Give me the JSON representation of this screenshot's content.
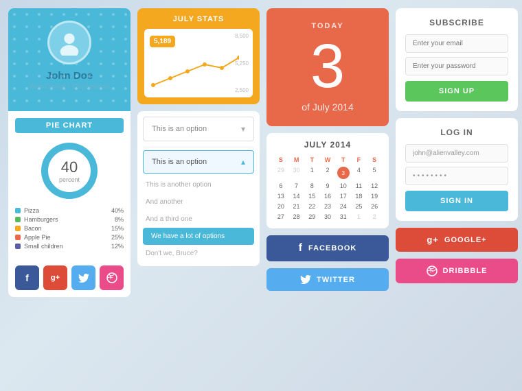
{
  "profile": {
    "name": "John Doe",
    "subtitle": "Web Design | Cluj Napoca",
    "pie_chart_label": "PIE CHART",
    "donut_value": "40",
    "donut_label": "percent",
    "legend": [
      {
        "label": "Pizza",
        "pct": "40%",
        "color": "#4ab8d8"
      },
      {
        "label": "Hamburgers",
        "pct": "8%",
        "color": "#5cb85c"
      },
      {
        "label": "Bacon",
        "pct": "15%",
        "color": "#f4a820"
      },
      {
        "label": "Apple Pie",
        "pct": "25%",
        "color": "#e8684a"
      },
      {
        "label": "Small children",
        "pct": "12%",
        "color": "#5b5ea6"
      }
    ]
  },
  "social_small": {
    "buttons": [
      "f",
      "g+",
      "t",
      "d"
    ]
  },
  "stats": {
    "title": "JULY STATS",
    "badge": "5,189",
    "y_labels": [
      "8,500",
      "5,250",
      "2,500"
    ]
  },
  "dropdown": {
    "select_label": "This is an option",
    "open_label": "This is an option",
    "options": [
      "This is another option",
      "And another",
      "And a third one",
      "We have a lot of options",
      "Don't we, Bruce?"
    ]
  },
  "today": {
    "label": "TODAY",
    "number": "3",
    "sub": "of July 2014"
  },
  "subscribe": {
    "title": "SUBSCRIBE",
    "email_placeholder": "Enter your email",
    "password_placeholder": "Enter your password",
    "button_label": "SIGN UP"
  },
  "calendar": {
    "title": "JULY 2014",
    "headers": [
      "S",
      "M",
      "T",
      "W",
      "T",
      "F",
      "S"
    ],
    "rows": [
      [
        "29",
        "30",
        "1",
        "2",
        "3",
        "4",
        "5"
      ],
      [
        "6",
        "7",
        "8",
        "9",
        "10",
        "11",
        "12"
      ],
      [
        "13",
        "14",
        "15",
        "16",
        "17",
        "18",
        "19"
      ],
      [
        "20",
        "21",
        "22",
        "23",
        "24",
        "25",
        "26"
      ],
      [
        "27",
        "28",
        "29",
        "30",
        "31",
        "1",
        "2"
      ]
    ],
    "today_day": "3",
    "muted": [
      "29",
      "30",
      "1",
      "2"
    ]
  },
  "facebook_btn": {
    "label": "FACEBOOK"
  },
  "twitter_btn": {
    "label": "TWITTER"
  },
  "login": {
    "title": "LOG IN",
    "email_value": "john@alienvalley.com",
    "password_value": "••••••••",
    "button_label": "SIGN IN"
  },
  "google_btn": {
    "label": "GOOGLE+"
  },
  "dribbble_btn": {
    "label": "DRIBBBLE"
  }
}
